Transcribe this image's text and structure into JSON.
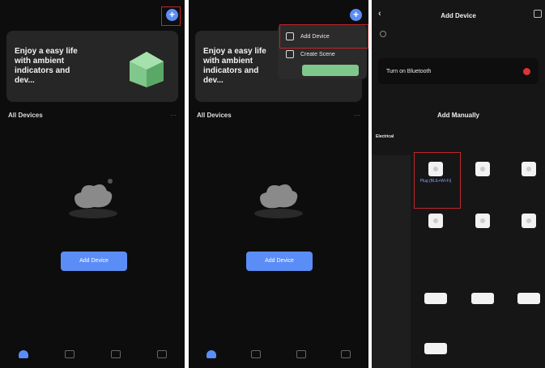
{
  "home": {
    "banner_text": "Enjoy a easy life with ambient indicators and dev...",
    "section_title": "All Devices",
    "add_button": "Add Device"
  },
  "menu": {
    "items": [
      "Add Device",
      "Create Scene"
    ]
  },
  "add_device": {
    "title": "Add Device",
    "bluetooth": "Turn on Bluetooth",
    "manually": "Add Manually",
    "categories": [
      "Electrical",
      "",
      "",
      "",
      "",
      "",
      "",
      "",
      ""
    ],
    "group_heads": [
      "",
      ""
    ],
    "devices": [
      "Plug (BLE+Wi-Fi)",
      "",
      "",
      "",
      "",
      "",
      "",
      "",
      "",
      ""
    ]
  },
  "colors": {
    "accent": "#5b8df6",
    "highlight": "#c0262c"
  }
}
